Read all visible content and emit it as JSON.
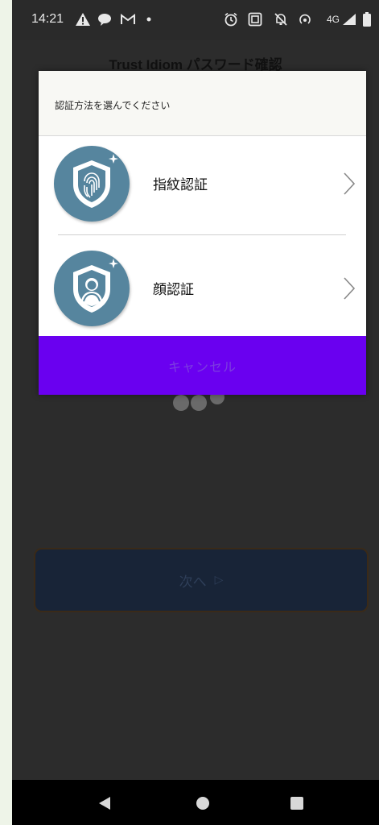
{
  "status_bar": {
    "time": "14:21",
    "network": "4G",
    "icons": [
      "warning-icon",
      "chat-icon",
      "gmail-icon",
      "dot-icon",
      "alarm-icon",
      "screen-icon",
      "silent-icon",
      "hotspot-icon",
      "signal-icon",
      "battery-icon"
    ]
  },
  "app": {
    "title": "Trust Idiom パスワード確認",
    "next_label": "次へ",
    "next_arrow": "▷"
  },
  "dialog": {
    "header": "認証方法を選んでください",
    "options": [
      {
        "label": "指紋認証",
        "icon": "fingerprint-shield-icon"
      },
      {
        "label": "顔認証",
        "icon": "face-shield-icon"
      }
    ],
    "cancel_label": "キャンセル"
  },
  "nav_bar": {
    "icons": [
      "back-icon",
      "home-icon",
      "recents-icon"
    ]
  },
  "colors": {
    "dialog_accent": "#6a00f0",
    "badge": "#56859e",
    "backdrop": "#2c2c2c"
  }
}
